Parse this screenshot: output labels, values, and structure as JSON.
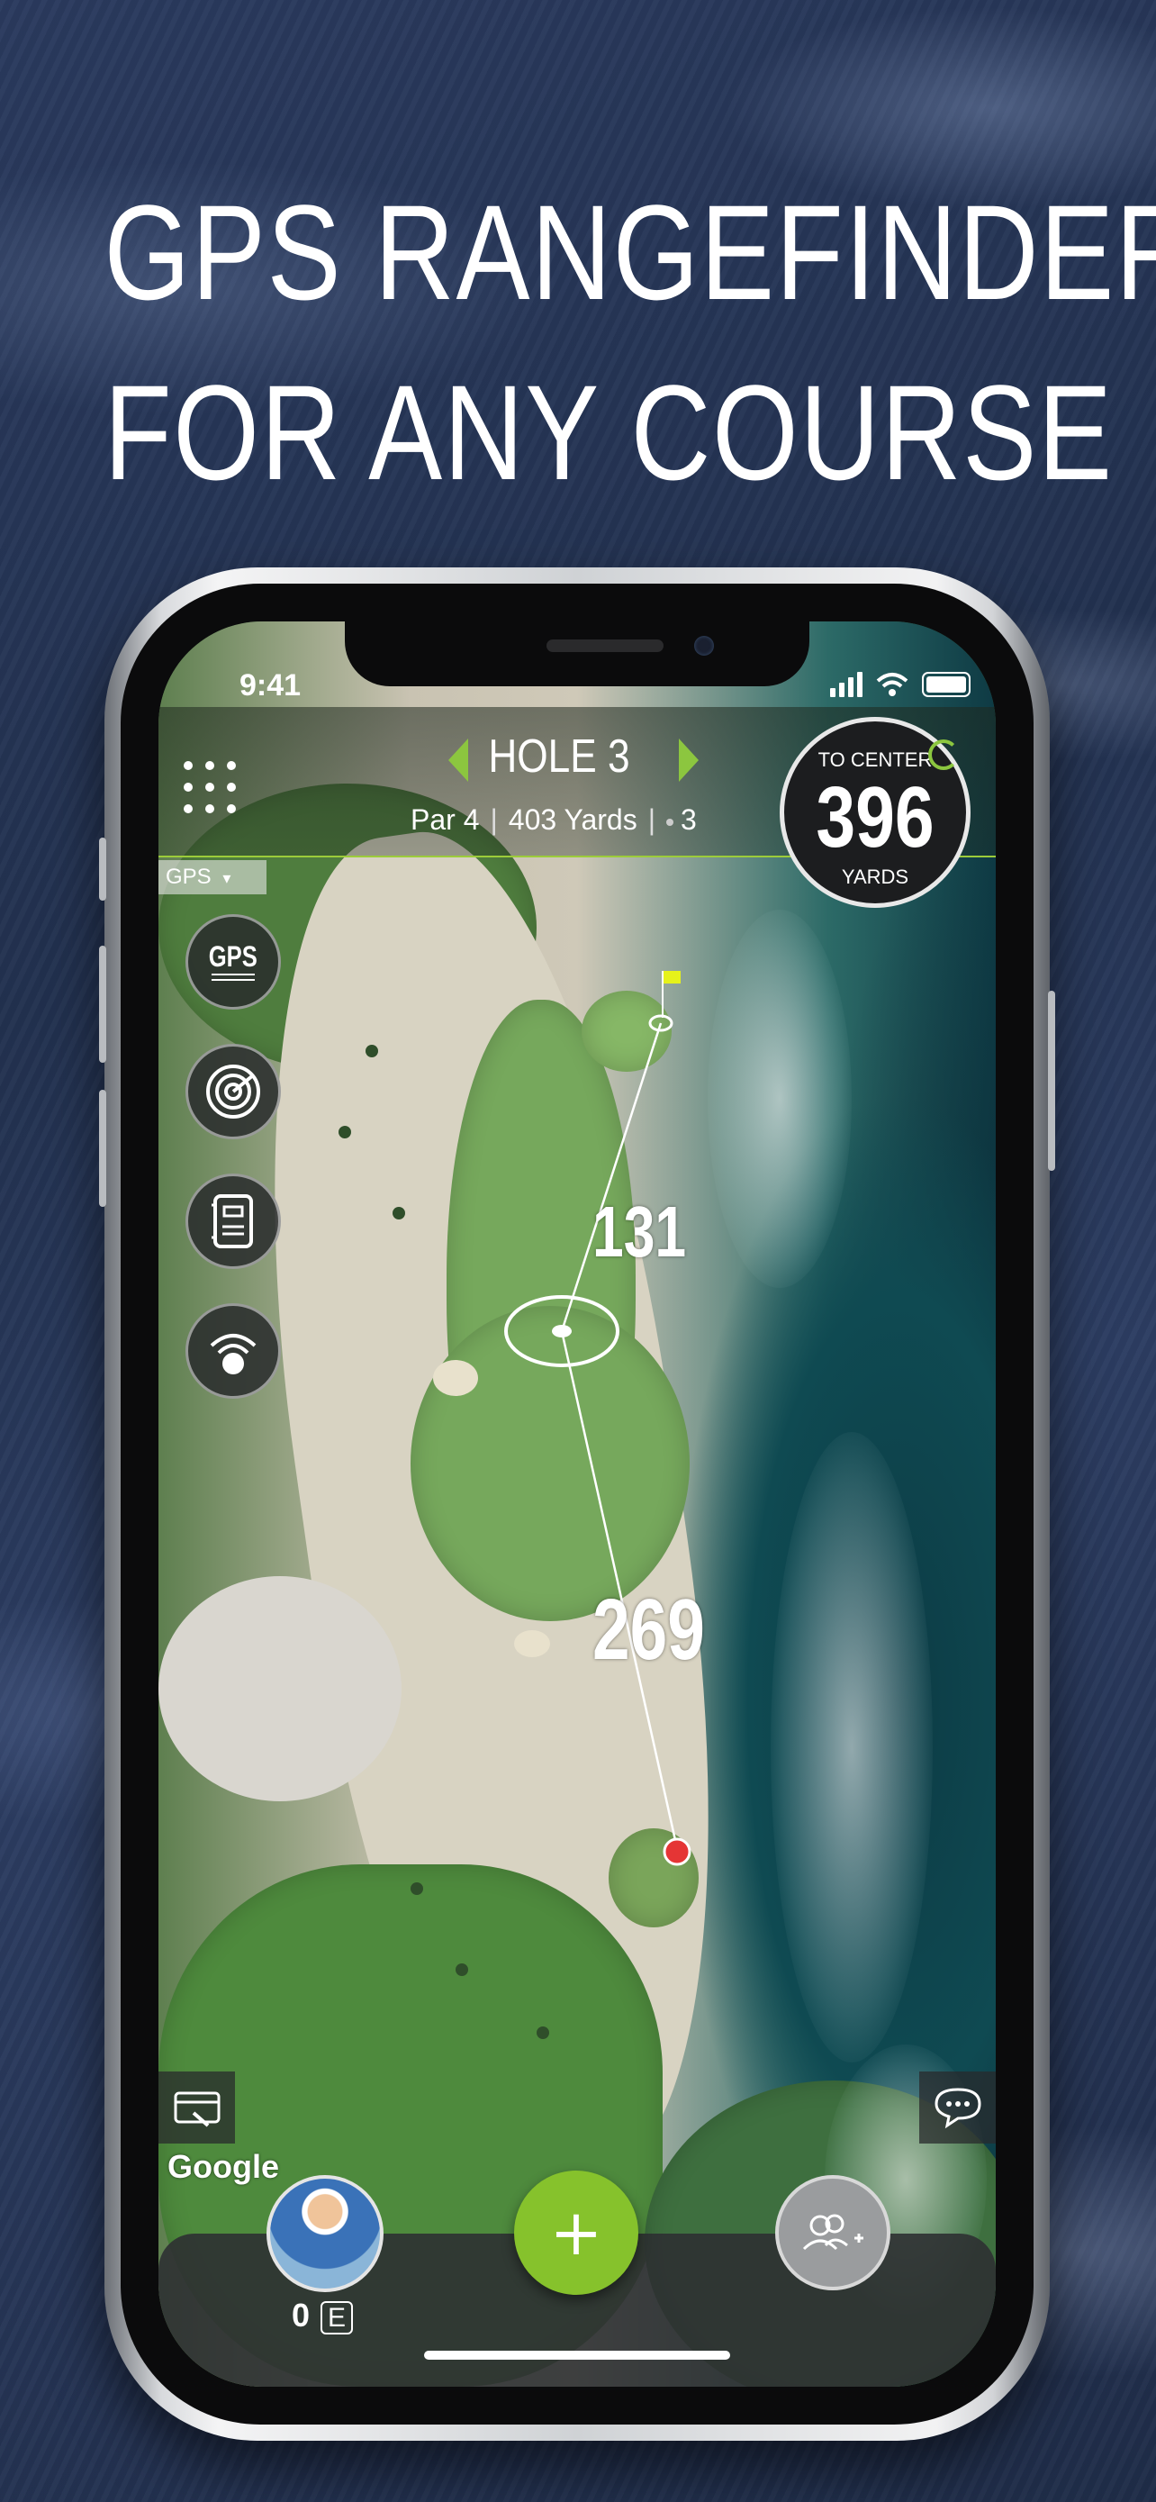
{
  "headline": {
    "line1": "GPS RANGEFINDER",
    "line2": "FOR ANY COURSE"
  },
  "status_bar": {
    "time": "9:41"
  },
  "hole": {
    "title": "HOLE 3",
    "par": "Par 4",
    "yards": "403 Yards",
    "handicap": "3"
  },
  "distance_badge": {
    "label": "TO CENTER",
    "value": "396",
    "unit": "YARDS"
  },
  "map": {
    "mode_dropdown": "GPS",
    "tools": [
      {
        "icon": "gps-icon",
        "label": "GPS"
      },
      {
        "icon": "radar-target-icon"
      },
      {
        "icon": "yardage-book-icon"
      },
      {
        "icon": "wifi-golf-ball-icon"
      }
    ],
    "yardage_to_pin": "131",
    "yardage_from_tee": "269",
    "attribution": "Google"
  },
  "bottom_bar": {
    "score": "0",
    "score_to_par": "E",
    "add_label": "+"
  },
  "colors": {
    "accent": "#8cc63f",
    "add_button": "#86c22c",
    "background": "#22314f"
  }
}
